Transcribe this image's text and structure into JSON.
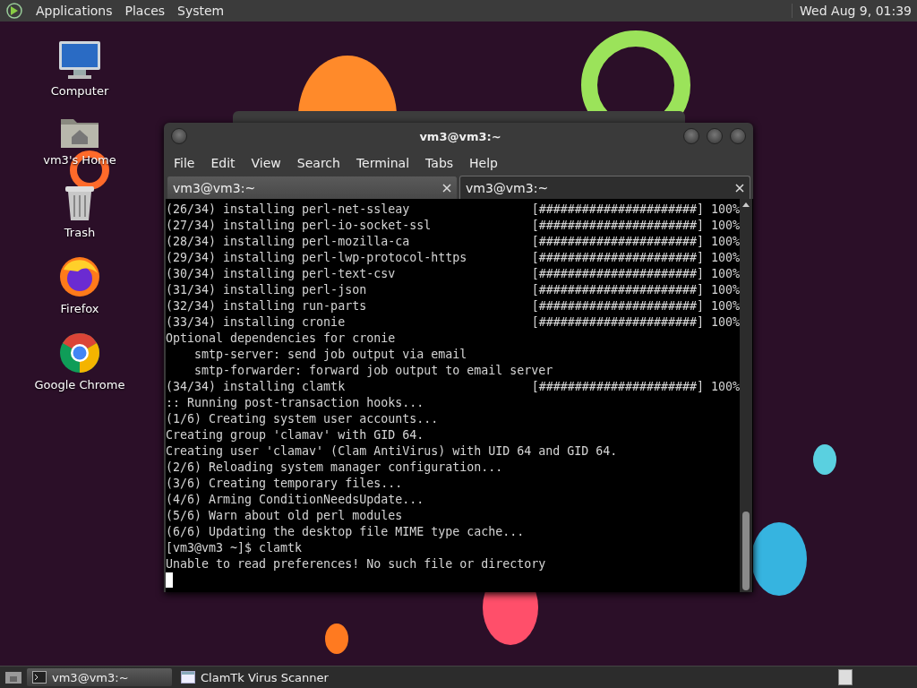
{
  "top_panel": {
    "menus": [
      "Applications",
      "Places",
      "System"
    ],
    "clock": "Wed Aug  9, 01:39"
  },
  "desktop_icons": [
    {
      "kind": "computer",
      "label": "Computer"
    },
    {
      "kind": "home",
      "label": "vm3's Home"
    },
    {
      "kind": "trash",
      "label": "Trash"
    },
    {
      "kind": "firefox",
      "label": "Firefox"
    },
    {
      "kind": "chrome",
      "label": "Google Chrome"
    }
  ],
  "terminal": {
    "title": "vm3@vm3:~",
    "menu": [
      "File",
      "Edit",
      "View",
      "Search",
      "Terminal",
      "Tabs",
      "Help"
    ],
    "tabs": [
      {
        "label": "vm3@vm3:~",
        "selected": false
      },
      {
        "label": "vm3@vm3:~",
        "selected": true
      }
    ],
    "lines": [
      {
        "text": "(26/34) installing perl-net-ssleay",
        "progress": "[######################] 100%"
      },
      {
        "text": "(27/34) installing perl-io-socket-ssl",
        "progress": "[######################] 100%"
      },
      {
        "text": "(28/34) installing perl-mozilla-ca",
        "progress": "[######################] 100%"
      },
      {
        "text": "(29/34) installing perl-lwp-protocol-https",
        "progress": "[######################] 100%"
      },
      {
        "text": "(30/34) installing perl-text-csv",
        "progress": "[######################] 100%"
      },
      {
        "text": "(31/34) installing perl-json",
        "progress": "[######################] 100%"
      },
      {
        "text": "(32/34) installing run-parts",
        "progress": "[######################] 100%"
      },
      {
        "text": "(33/34) installing cronie",
        "progress": "[######################] 100%"
      },
      {
        "text": "Optional dependencies for cronie"
      },
      {
        "text": "    smtp-server: send job output via email"
      },
      {
        "text": "    smtp-forwarder: forward job output to email server"
      },
      {
        "text": "(34/34) installing clamtk",
        "progress": "[######################] 100%"
      },
      {
        "text": ":: Running post-transaction hooks..."
      },
      {
        "text": "(1/6) Creating system user accounts..."
      },
      {
        "text": "Creating group 'clamav' with GID 64."
      },
      {
        "text": "Creating user 'clamav' (Clam AntiVirus) with UID 64 and GID 64."
      },
      {
        "text": "(2/6) Reloading system manager configuration..."
      },
      {
        "text": "(3/6) Creating temporary files..."
      },
      {
        "text": "(4/6) Arming ConditionNeedsUpdate..."
      },
      {
        "text": "(5/6) Warn about old perl modules"
      },
      {
        "text": "(6/6) Updating the desktop file MIME type cache..."
      },
      {
        "text": "[vm3@vm3 ~]$ clamtk"
      },
      {
        "text": "Unable to read preferences! No such file or directory"
      }
    ]
  },
  "taskbar": {
    "items": [
      {
        "kind": "terminal",
        "label": "vm3@vm3:~",
        "selected": true
      },
      {
        "kind": "window",
        "label": "ClamTk Virus Scanner",
        "selected": false
      }
    ]
  }
}
